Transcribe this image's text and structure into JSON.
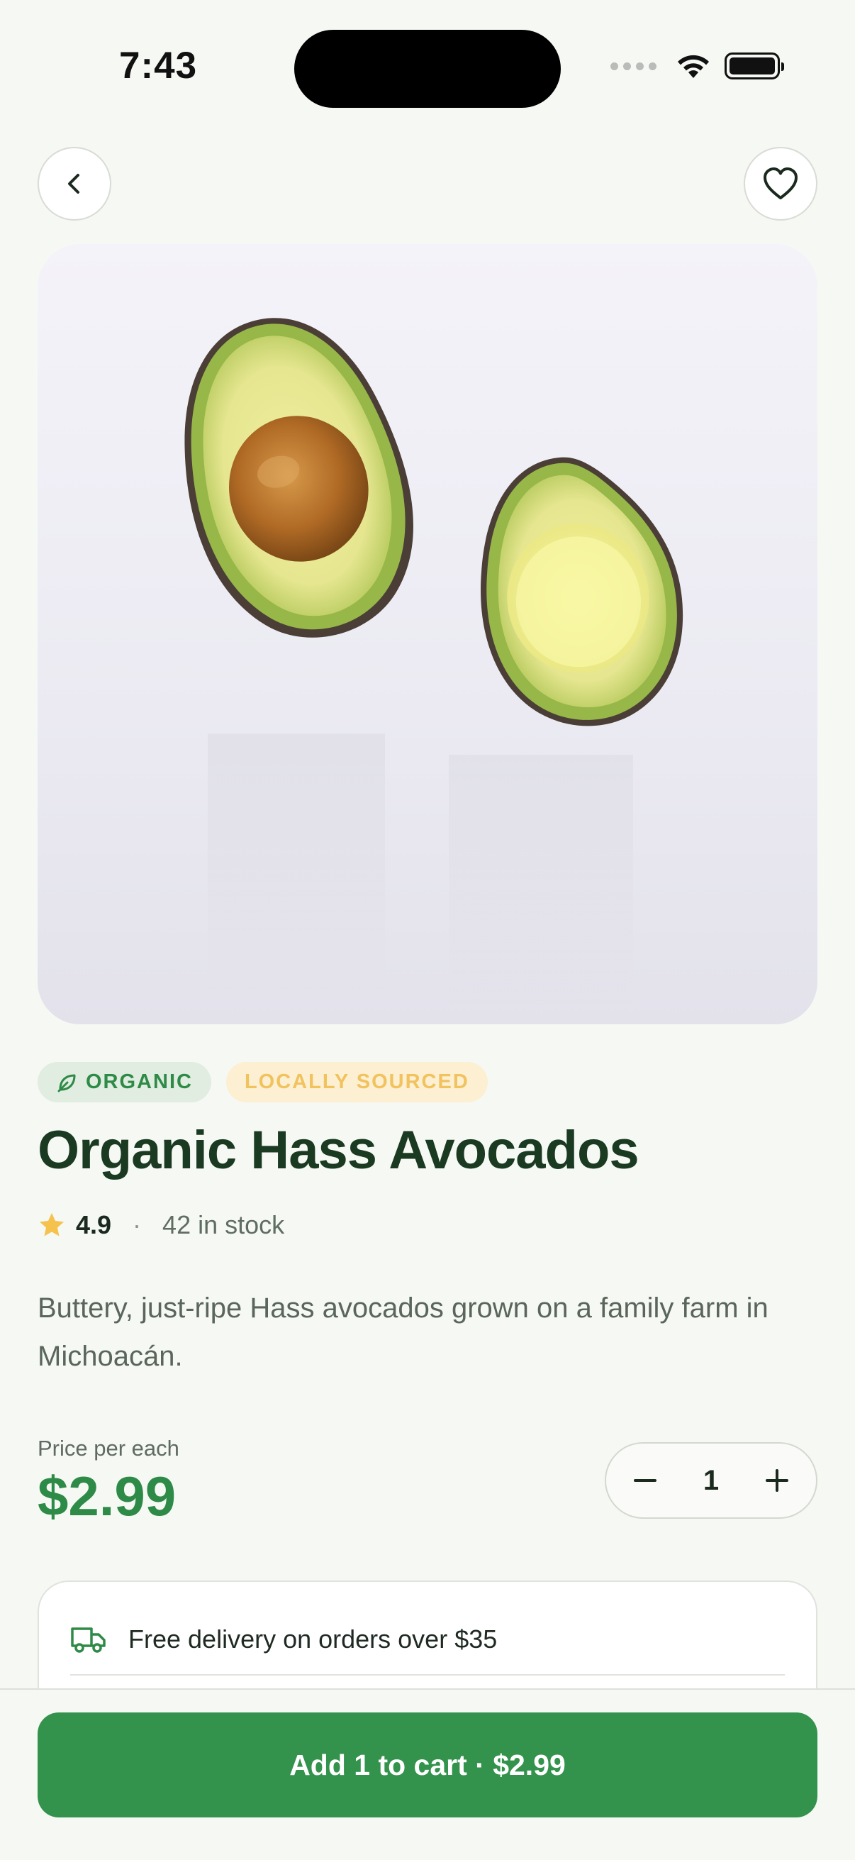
{
  "status_bar": {
    "time": "7:43"
  },
  "header": {
    "back_icon": "chevron-left-icon",
    "favorite_icon": "heart-icon"
  },
  "product": {
    "image_alt": "Two halves of an avocado",
    "tags": [
      {
        "label": "ORGANIC",
        "icon": "leaf-icon"
      },
      {
        "label": "LOCALLY SOURCED"
      }
    ],
    "title": "Organic Hass Avocados",
    "rating": "4.9",
    "separator": "·",
    "stock": "42 in stock",
    "description": "Buttery, just-ripe Hass avocados grown on a family farm in Michoacán.",
    "price_label": "Price per each",
    "price": "$2.99",
    "quantity": "1"
  },
  "delivery": {
    "text": "Free delivery on orders over $35",
    "icon": "truck-icon"
  },
  "cta": {
    "label": "Add 1 to cart · $2.99"
  },
  "colors": {
    "brand_green": "#33924c",
    "price_green": "#2e8a47",
    "tag_yellow": "#f1c25d"
  }
}
